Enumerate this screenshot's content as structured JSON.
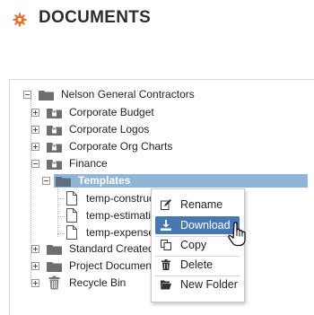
{
  "header": {
    "title": "DOCUMENTS",
    "icon": "gear-icon",
    "accent": "#e8702a"
  },
  "tree": {
    "root": {
      "label": "Nelson General Contractors"
    },
    "folders": [
      {
        "label": "Corporate Budget",
        "icon": "locked-folder-icon"
      },
      {
        "label": "Corporate Logos",
        "icon": "locked-folder-icon"
      },
      {
        "label": "Corporate Org Charts",
        "icon": "locked-folder-icon"
      },
      {
        "label": "Finance",
        "icon": "locked-folder-icon"
      },
      {
        "label": "Templates",
        "icon": "folder-icon",
        "selected": true
      },
      {
        "label": "temp-construc",
        "icon": "file-icon"
      },
      {
        "label": "temp-estimatio",
        "icon": "file-icon"
      },
      {
        "label": "temp-expense",
        "icon": "file-icon"
      },
      {
        "label": "Standard Created",
        "icon": "folder-icon"
      },
      {
        "label": "Project Document",
        "icon": "folder-icon"
      },
      {
        "label": "Recycle Bin",
        "icon": "trash-icon"
      }
    ]
  },
  "context_menu": {
    "items": [
      {
        "label": "Rename",
        "icon": "edit-icon"
      },
      {
        "label": "Download",
        "icon": "download-icon",
        "highlighted": true
      },
      {
        "label": "Copy",
        "icon": "copy-icon"
      },
      {
        "label": "Delete",
        "icon": "trash-icon"
      },
      {
        "label": "New Folder",
        "icon": "folder-open-icon"
      }
    ],
    "highlight_color": "#4778b4"
  },
  "colors": {
    "selected_row": "#8fb4d6",
    "folder": "#6e6e6e"
  }
}
